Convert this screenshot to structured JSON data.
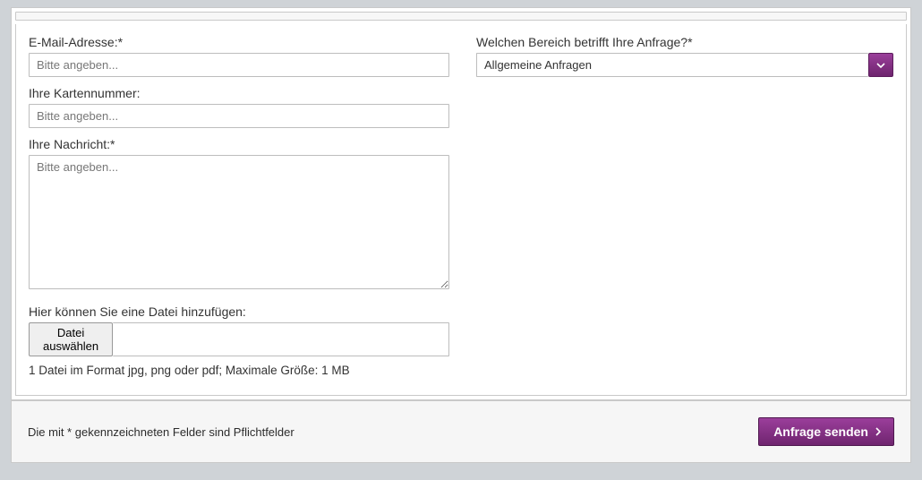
{
  "left": {
    "email": {
      "label": "E-Mail-Adresse:*",
      "placeholder": "Bitte angeben..."
    },
    "card": {
      "label": "Ihre Kartennummer:",
      "placeholder": "Bitte angeben..."
    },
    "message": {
      "label": "Ihre Nachricht:*",
      "placeholder": "Bitte angeben..."
    },
    "file": {
      "label": "Hier können Sie eine Datei hinzufügen:",
      "button": "Datei auswählen",
      "hint": "1 Datei im Format jpg, png oder pdf; Maximale Größe: 1 MB"
    }
  },
  "right": {
    "area": {
      "label": "Welchen Bereich betrifft Ihre Anfrage?*",
      "selected": "Allgemeine Anfragen"
    }
  },
  "footer": {
    "note": "Die mit * gekennzeichneten Felder sind Pflichtfelder",
    "submit": "Anfrage senden"
  },
  "colors": {
    "accent": "#7a2a7a"
  }
}
